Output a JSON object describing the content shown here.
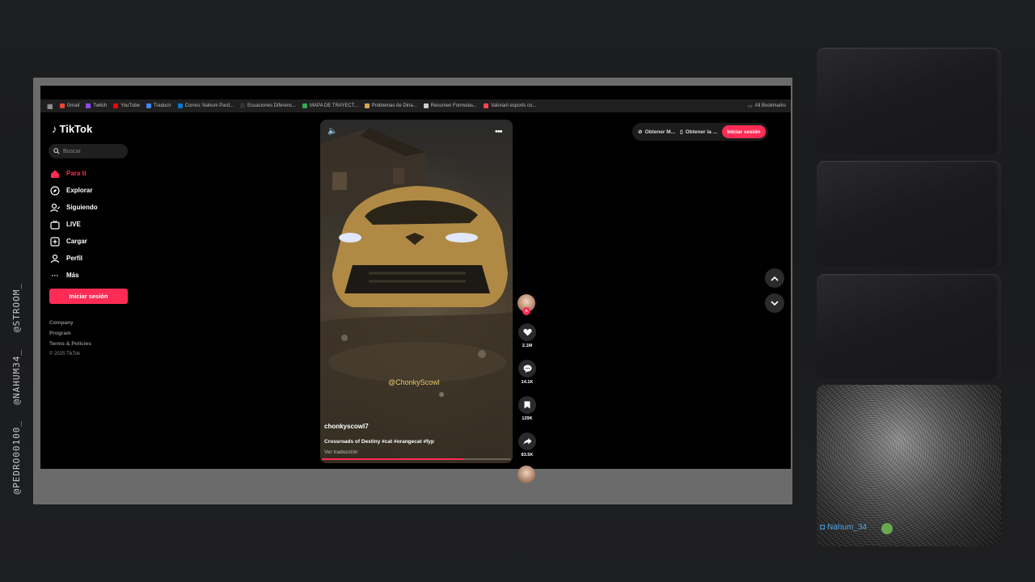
{
  "stream": {
    "handles": [
      "@STROOM_",
      "@NAHUM34_",
      "@PEDRO00100_"
    ],
    "webcam_name": "Nahum_34"
  },
  "bookmarks": [
    {
      "label": "Gmail",
      "color": "#ea4335"
    },
    {
      "label": "Twitch",
      "color": "#9146ff"
    },
    {
      "label": "YouTube",
      "color": "#ff0000"
    },
    {
      "label": "Traducir",
      "color": "#4285f4"
    },
    {
      "label": "Correo: Nahum Pard...",
      "color": "#0078d4"
    },
    {
      "label": "Ecuaciones Diferenc...",
      "color": "#333333"
    },
    {
      "label": "MAPA DE TRAYECT...",
      "color": "#34a853"
    },
    {
      "label": "Problemas de Dina...",
      "color": "#d9a54a"
    },
    {
      "label": "Resumen Formulas...",
      "color": "#cccccc"
    },
    {
      "label": "Valorant esports co...",
      "color": "#ff4655"
    }
  ],
  "bookmarks_all": "All Bookmarks",
  "tiktok": {
    "logo": "TikTok",
    "search_placeholder": "Buscar",
    "nav": [
      {
        "label": "Para ti",
        "icon": "home-icon",
        "active": true
      },
      {
        "label": "Explorar",
        "icon": "compass-icon",
        "active": false
      },
      {
        "label": "Siguiendo",
        "icon": "following-icon",
        "active": false
      },
      {
        "label": "LIVE",
        "icon": "live-icon",
        "active": false
      },
      {
        "label": "Cargar",
        "icon": "upload-icon",
        "active": false
      },
      {
        "label": "Perfil",
        "icon": "profile-icon",
        "active": false
      },
      {
        "label": "Más",
        "icon": "more-icon",
        "active": false
      }
    ],
    "login_button": "Iniciar sesión",
    "footer": [
      "Company",
      "Program",
      "Terms & Policies"
    ],
    "copyright": "© 2025 TikTok",
    "top_right": {
      "get_app": "Obtener M...",
      "get_desktop": "Obtener la ...",
      "login": "Iniciar sesión"
    },
    "video": {
      "watermark": "@ChonkyScowl",
      "author": "chonkyscowl7",
      "caption": "Crossroads of Destiny #cat #orangecat #fyp",
      "translate": "Ver traducción",
      "progress": 0.75
    },
    "actions": {
      "likes": "2.1M",
      "comments": "14.1K",
      "saves": "129K",
      "shares": "83.5K"
    }
  }
}
